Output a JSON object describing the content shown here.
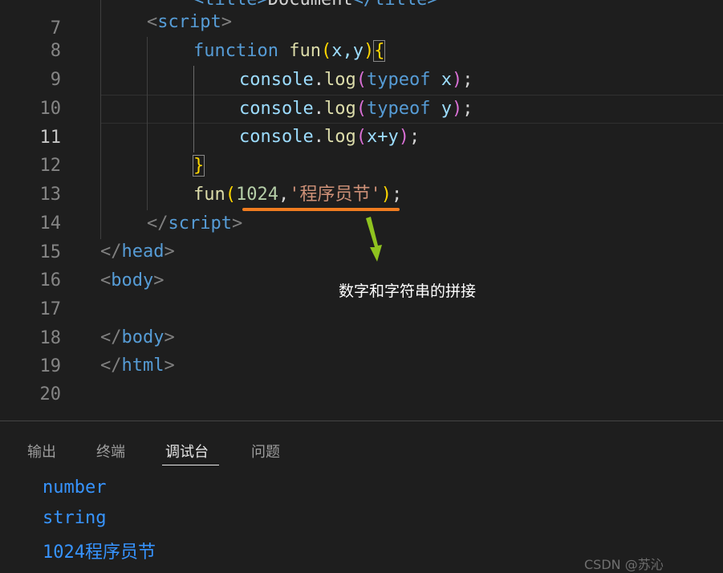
{
  "editor": {
    "line_numbers": {
      "l7": "7",
      "l8": "8",
      "l9": "9",
      "l10": "10",
      "l11": "11",
      "l12": "12",
      "l13": "13",
      "l14": "14",
      "l15": "15",
      "l16": "16",
      "l17": "17",
      "l18": "18",
      "l19": "19",
      "l20": "20"
    },
    "active_line": "11",
    "tokens": {
      "l7_title_open": "<title>",
      "l7_doc": "Document",
      "l7_title_close": "</title>",
      "script_tag": "script",
      "kw_function": "function",
      "fn_name": "fun",
      "params": "x,y",
      "console": "console",
      "log": "log",
      "kw_typeof": "typeof",
      "var_x": "x",
      "var_y": "y",
      "expr_sum": "x+y",
      "arg_num": "1024",
      "arg_str": "'程序员节'",
      "head_tag": "head",
      "body_tag": "body",
      "html_tag": "html"
    }
  },
  "annotation": {
    "text": "数字和字符串的拼接",
    "underline_color": "#f07c20",
    "arrow_color": "#8fc31f"
  },
  "panel": {
    "tabs": [
      "输出",
      "终端",
      "调试台",
      "问题"
    ],
    "active_tab": "调试台",
    "output": [
      "number",
      "string",
      "1024程序员节"
    ]
  },
  "watermark": "CSDN @苏沁",
  "colors": {
    "background": "#1e1e1e",
    "keyword": "#569cd6",
    "function": "#dcdcaa",
    "variable": "#9cdcfe",
    "number": "#b5cea8",
    "string": "#ce9178",
    "output_text": "#3794ff"
  }
}
